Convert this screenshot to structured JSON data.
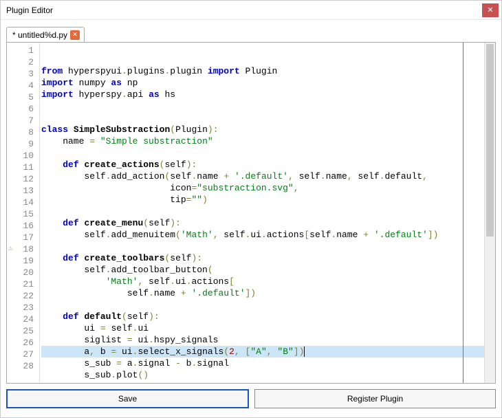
{
  "window": {
    "title": "Plugin Editor"
  },
  "tab": {
    "label": "* untitled%d.py"
  },
  "buttons": {
    "save": "Save",
    "register": "Register Plugin"
  },
  "editor": {
    "highlighted_line": 25,
    "warning_line": 18,
    "line_count": 28,
    "code_plain": [
      "from hyperspyui.plugins.plugin import Plugin",
      "import numpy as np",
      "import hyperspy.api as hs",
      "",
      "",
      "class SimpleSubstraction(Plugin):",
      "    name = \"Simple substraction\"",
      "",
      "    def create_actions(self):",
      "        self.add_action(self.name + '.default', self.name, self.default,",
      "                        icon=\"substraction.svg\",",
      "                        tip=\"\")",
      "",
      "    def create_menu(self):",
      "        self.add_menuitem('Math', self.ui.actions[self.name + '.default'])",
      "",
      "    def create_toolbars(self):",
      "        self.add_toolbar_button(",
      "            'Math', self.ui.actions[",
      "                self.name + '.default'])",
      "",
      "    def default(self):",
      "        ui = self.ui",
      "        siglist = ui.hspy_signals",
      "        a, b = ui.select_x_signals(2, [\"A\", \"B\"])",
      "        s_sub = a.signal - b.signal",
      "        s_sub.plot()",
      ""
    ],
    "code_html": [
      "<span class='kw'>from</span> hyperspyui<span class='op'>.</span>plugins<span class='op'>.</span>plugin <span class='kw'>import</span> Plugin",
      "<span class='kw'>import</span> numpy <span class='kw'>as</span> np",
      "<span class='kw'>import</span> hyperspy<span class='op'>.</span>api <span class='kw'>as</span> hs",
      "",
      "",
      "<span class='kw'>class</span> <span class='cls'>SimpleSubstraction</span><span class='op'>(</span>Plugin<span class='op'>):</span>",
      "    name <span class='op'>=</span> <span class='str'>\"Simple substraction\"</span>",
      "",
      "    <span class='kw'>def</span> <span class='cls'>create_actions</span><span class='op'>(</span>self<span class='op'>):</span>",
      "        self<span class='op'>.</span>add_action<span class='op'>(</span>self<span class='op'>.</span>name <span class='op'>+</span> <span class='str'>'.default'</span><span class='op'>,</span> self<span class='op'>.</span>name<span class='op'>,</span> self<span class='op'>.</span>default<span class='op'>,</span>",
      "                        icon<span class='op'>=</span><span class='str'>\"substraction.svg\"</span><span class='op'>,</span>",
      "                        tip<span class='op'>=</span><span class='str'>\"\"</span><span class='op'>)</span>",
      "",
      "    <span class='kw'>def</span> <span class='cls'>create_menu</span><span class='op'>(</span>self<span class='op'>):</span>",
      "        self<span class='op'>.</span>add_menuitem<span class='op'>(</span><span class='str'>'Math'</span><span class='op'>,</span> self<span class='op'>.</span>ui<span class='op'>.</span>actions<span class='op'>[</span>self<span class='op'>.</span>name <span class='op'>+</span> <span class='str'>'.default'</span><span class='op'>])</span>",
      "",
      "    <span class='kw'>def</span> <span class='cls'>create_toolbars</span><span class='op'>(</span>self<span class='op'>):</span>",
      "        self<span class='op'>.</span>add_toolbar_button<span class='op'>(</span>",
      "            <span class='str'>'Math'</span><span class='op'>,</span> self<span class='op'>.</span>ui<span class='op'>.</span>actions<span class='op'>[</span>",
      "                self<span class='op'>.</span>name <span class='op'>+</span> <span class='str'>'.default'</span><span class='op'>])</span>",
      "",
      "    <span class='kw'>def</span> <span class='cls'>default</span><span class='op'>(</span>self<span class='op'>):</span>",
      "        ui <span class='op'>=</span> self<span class='op'>.</span>ui",
      "        siglist <span class='op'>=</span> ui<span class='op'>.</span>hspy_signals",
      "        a<span class='op'>,</span> b <span class='op'>=</span> ui<span class='op'>.</span>select_x_signals<span class='op'>(</span><span class='num'>2</span><span class='op'>,</span> <span class='op'>[</span><span class='str'>\"A\"</span><span class='op'>,</span> <span class='str'>\"B\"</span><span class='op'>])</span><span class='caret'></span>",
      "        s_sub <span class='op'>=</span> a<span class='op'>.</span>signal <span class='op'>-</span> b<span class='op'>.</span>signal",
      "        s_sub<span class='op'>.</span>plot<span class='op'>()</span>",
      ""
    ]
  }
}
